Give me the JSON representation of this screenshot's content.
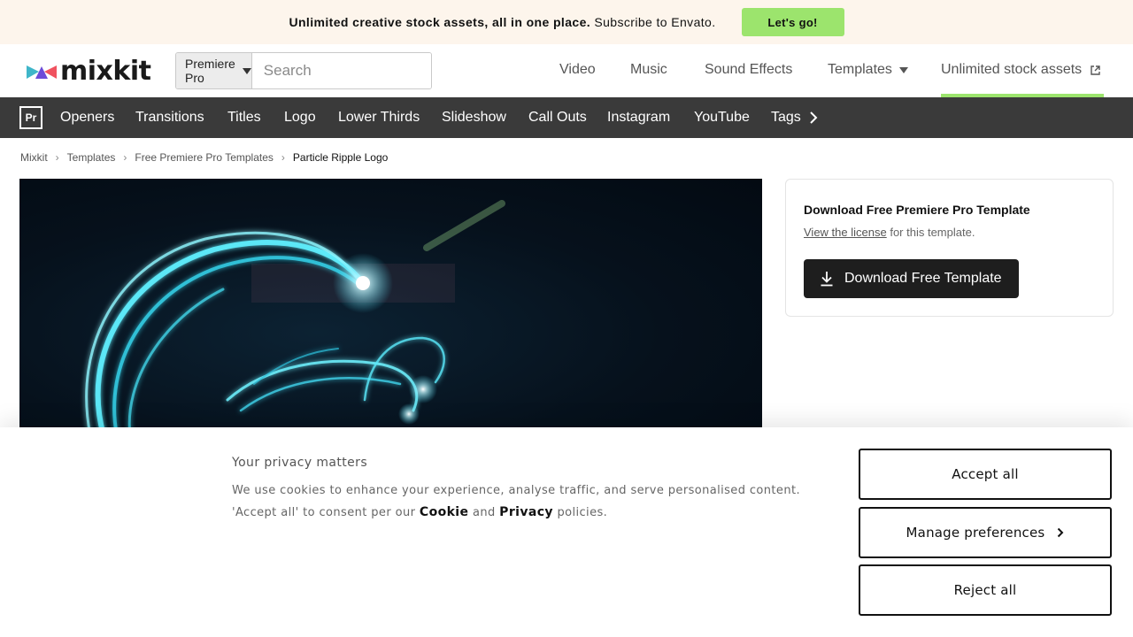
{
  "promo": {
    "headline": "Unlimited creative stock assets, all in one place.",
    "tail": "Subscribe to Envato.",
    "cta": "Let's go!",
    "cta_color": "#9ce46d"
  },
  "header": {
    "logo_text": "mixkit",
    "search": {
      "category": "Premiere Pro",
      "placeholder": "Search"
    },
    "nav": {
      "video": "Video",
      "music": "Music",
      "sound_effects": "Sound Effects",
      "templates": "Templates",
      "unlimited": "Unlimited stock assets"
    }
  },
  "categories": {
    "badge": "Pr",
    "items": [
      "Openers",
      "Transitions",
      "Titles",
      "Logo",
      "Lower Thirds",
      "Slideshow",
      "Call Outs",
      "Instagram",
      "YouTube",
      "Tags"
    ]
  },
  "breadcrumb": [
    "Mixkit",
    "Templates",
    "Free Premiere Pro Templates",
    "Particle Ripple Logo"
  ],
  "download": {
    "title": "Download Free Premiere Pro Template",
    "license_link": "View the license",
    "license_tail": "for this template.",
    "button": "Download Free Template"
  },
  "cookie": {
    "title": "Your privacy matters",
    "text_1": "We use cookies to enhance your experience, analyse traffic, and serve personalised content. 'Accept all' to consent per our",
    "cookie_link": "Cookie",
    "text_and": "and",
    "privacy_link": "Privacy",
    "text_end": "policies.",
    "accept": "Accept all",
    "manage": "Manage preferences",
    "reject": "Reject all"
  }
}
